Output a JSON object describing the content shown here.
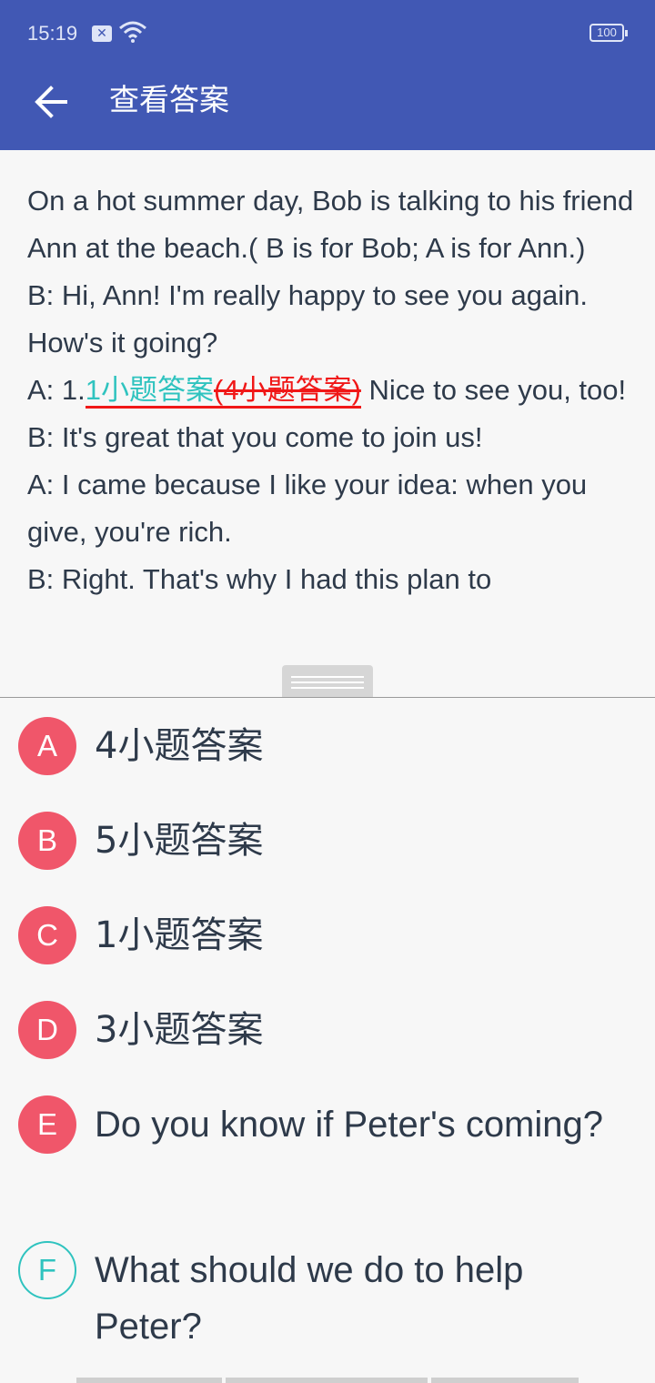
{
  "status_bar": {
    "time": "15:19",
    "notification_icon": "x-box-icon",
    "wifi_icon": "wifi-icon",
    "battery": "100"
  },
  "app_bar": {
    "back_icon": "arrow-left-icon",
    "title": "查看答案"
  },
  "passage": {
    "lines": [
      "On a hot summer day, Bob is talking to his friend Ann at the beach.( B is for Bob; A is for Ann.)",
      "B: Hi, Ann! I'm really happy to see you again. How's it going?"
    ],
    "answer_line": {
      "prefix": "A: 1.",
      "correct_answer": "1小题答案",
      "wrong_answer": "(4小题答案)",
      "suffix": " Nice to see you, too!"
    },
    "lines_after": [
      "B: It's great that you come to join us!",
      "A: I came because I like your idea: when you give, you're rich.",
      "B: Right. That's why I had this plan to"
    ]
  },
  "options": [
    {
      "letter": "A",
      "text": "4小题答案"
    },
    {
      "letter": "B",
      "text": "5小题答案"
    },
    {
      "letter": "C",
      "text": "1小题答案"
    },
    {
      "letter": "D",
      "text": "3小题答案"
    },
    {
      "letter": "E",
      "text": "Do you know if Peter's coming?"
    },
    {
      "letter": "F",
      "text": "What should we do to help Peter?"
    }
  ],
  "colors": {
    "app_bar": "#4158b4",
    "option_badge": "#f0566a",
    "correct": "#2fc3bf",
    "wrong": "#f01717"
  }
}
